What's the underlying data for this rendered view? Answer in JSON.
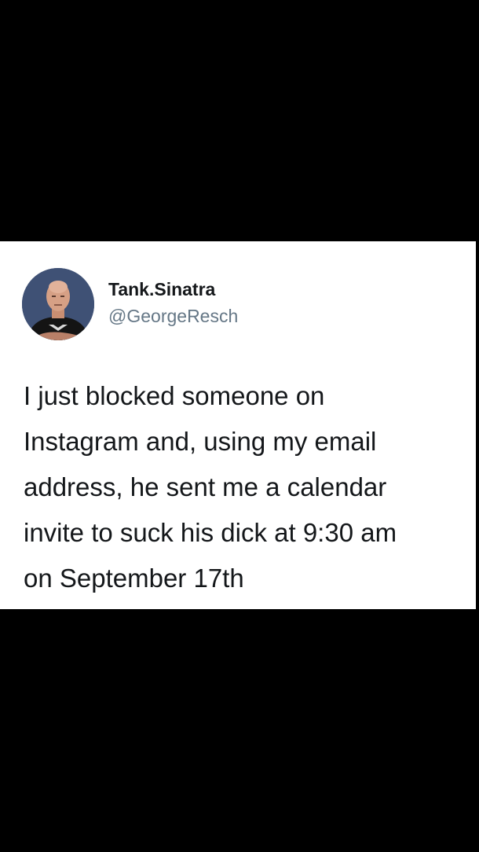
{
  "tweet": {
    "display_name": "Tank.Sinatra",
    "handle": "@GeorgeResch",
    "text": "I just blocked someone on\nInstagram and, using my email\naddress, he sent me a calendar\ninvite to suck his dick at 9:30 am\non September 17th",
    "avatar_icon": "profile-photo"
  },
  "colors": {
    "background": "#000000",
    "card": "#ffffff",
    "name": "#14171a",
    "handle": "#657786"
  }
}
